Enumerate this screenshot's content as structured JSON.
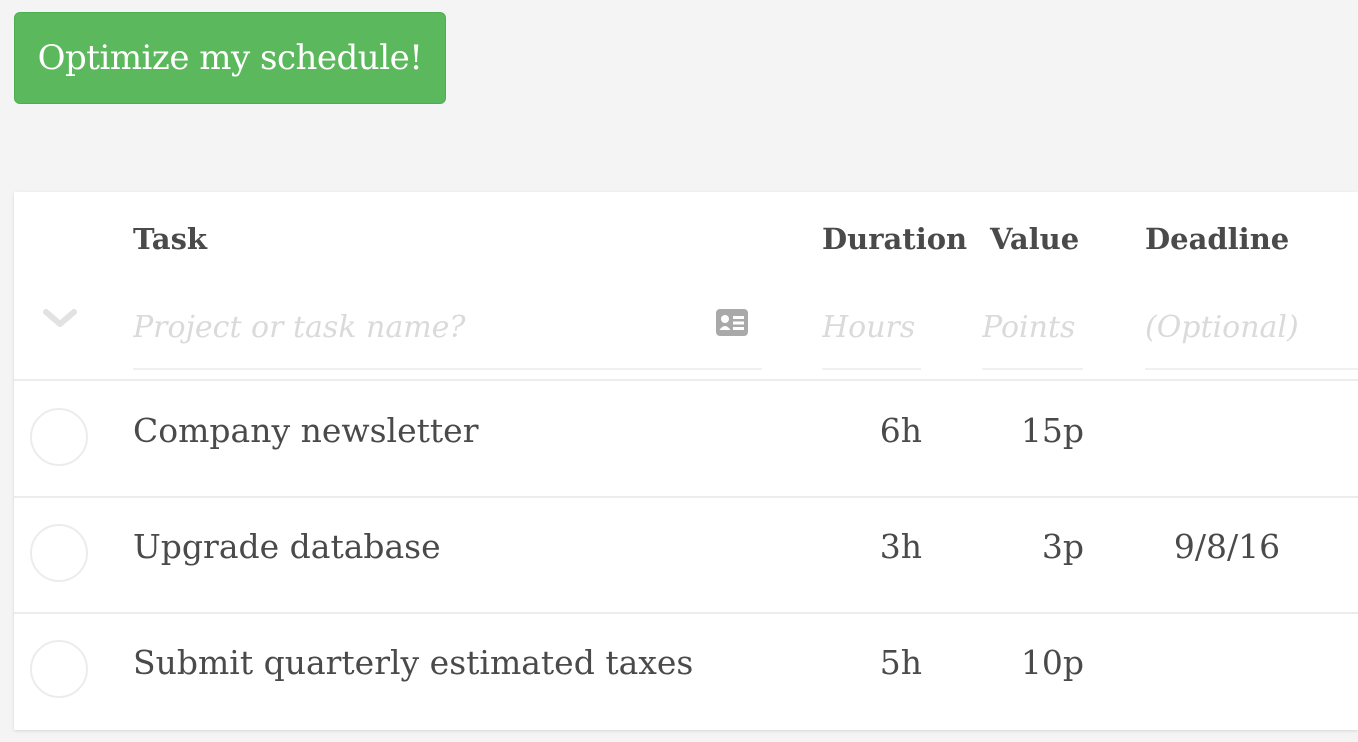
{
  "optimize_button": {
    "label": "Optimize my schedule!",
    "color": "#5cb85c"
  },
  "columns": {
    "task": "Task",
    "duration": "Duration",
    "value": "Value",
    "deadline": "Deadline"
  },
  "new_task": {
    "expand_icon": "chevron-down-icon",
    "name_placeholder": "Project or task name?",
    "details_icon": "id-card-icon",
    "duration_placeholder": "Hours",
    "value_placeholder": "Points",
    "deadline_placeholder": "(Optional)"
  },
  "tasks": [
    {
      "name": "Company newsletter",
      "duration": "6h",
      "value": "15p",
      "deadline": ""
    },
    {
      "name": "Upgrade database",
      "duration": "3h",
      "value": "3p",
      "deadline": "9/8/16"
    },
    {
      "name": "Submit quarterly estimated taxes",
      "duration": "5h",
      "value": "10p",
      "deadline": ""
    }
  ]
}
